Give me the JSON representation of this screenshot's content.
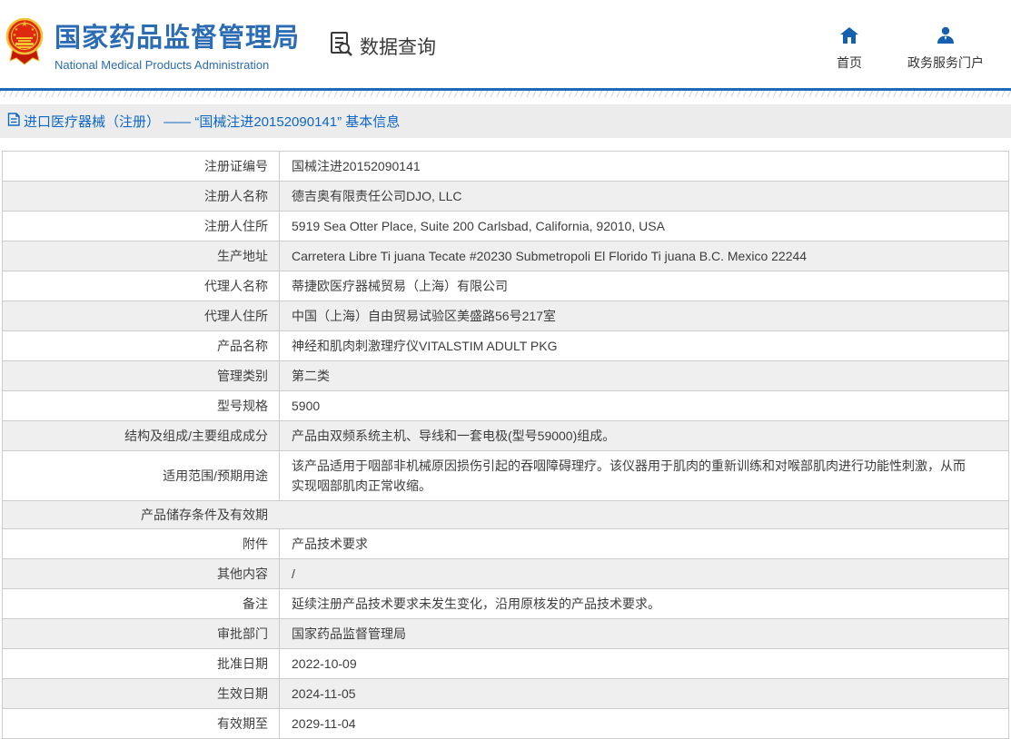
{
  "header": {
    "logo_icon": "national-emblem-icon",
    "title": "国家药品监督管理局",
    "subtitle": "National Medical Products Administration",
    "data_query": {
      "icon": "document-search-icon",
      "label": "数据查询"
    },
    "nav": [
      {
        "icon": "home-icon",
        "label": "首页"
      },
      {
        "icon": "user-icon",
        "label": "政务服务门户"
      }
    ],
    "colors": {
      "brand_blue": "#2b6cb5",
      "icon_blue": "#1460af",
      "accent_line_blue": "#1e6cb8",
      "emblem_red": "#de2910",
      "emblem_gold": "#f2c231"
    }
  },
  "breadcrumb": {
    "icon": "page-icon",
    "text": "进口医疗器械（注册） —— “国械注进20152090141” 基本信息",
    "color": "#0d67c6"
  },
  "table": {
    "row_alt_color": "#efefef",
    "border_color": "#cccccc",
    "rows": [
      {
        "label": "注册证编号",
        "value": "国械注进20152090141"
      },
      {
        "label": "注册人名称",
        "value": "德吉奥有限责任公司DJO, LLC"
      },
      {
        "label": "注册人住所",
        "value": "5919 Sea Otter Place, Suite 200 Carlsbad, California, 92010, USA"
      },
      {
        "label": "生产地址",
        "value": "Carretera Libre Ti juana Tecate #20230 Submetropoli El Florido Ti juana B.C. Mexico 22244"
      },
      {
        "label": "代理人名称",
        "value": "蒂捷欧医疗器械贸易（上海）有限公司"
      },
      {
        "label": "代理人住所",
        "value": "中国（上海）自由贸易试验区美盛路56号217室"
      },
      {
        "label": "产品名称",
        "value": "神经和肌肉刺激理疗仪VITALSTIM ADULT PKG"
      },
      {
        "label": "管理类别",
        "value": "第二类"
      },
      {
        "label": "型号规格",
        "value": "5900"
      },
      {
        "label": "结构及组成/主要组成成分",
        "value": "产品由双频系统主机、导线和一套电极(型号59000)组成。"
      },
      {
        "label": "适用范围/预期用途",
        "value": "该产品适用于咽部非机械原因损伤引起的吞咽障碍理疗。该仪器用于肌肉的重新训练和对喉部肌肉进行功能性刺激，从而实现咽部肌肉正常收缩。"
      },
      {
        "label": "产品储存条件及有效期",
        "value": ""
      },
      {
        "label": "附件",
        "value": "产品技术要求"
      },
      {
        "label": "其他内容",
        "value": "/"
      },
      {
        "label": "备注",
        "value": "延续注册产品技术要求未发生变化，沿用原核发的产品技术要求。"
      },
      {
        "label": "审批部门",
        "value": "国家药品监督管理局"
      },
      {
        "label": "批准日期",
        "value": "2022-10-09"
      },
      {
        "label": "生效日期",
        "value": "2024-11-05"
      },
      {
        "label": "有效期至",
        "value": "2029-11-04"
      }
    ]
  }
}
